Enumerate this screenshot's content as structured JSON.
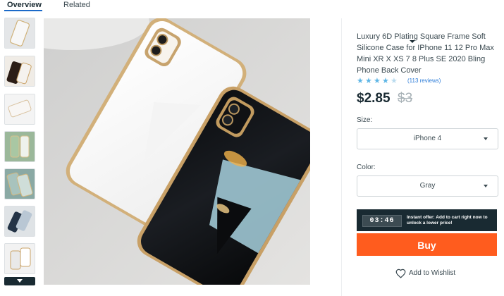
{
  "tabs": [
    {
      "label": "Overview",
      "active": true
    },
    {
      "label": "Related",
      "active": false
    }
  ],
  "gallery": {
    "thumbnail_count": 7,
    "more_icon": "chevron-down-icon"
  },
  "product": {
    "title": "Luxury 6D Plating Square Frame Soft Silicone Case for IPhone 11 12 Pro Max Mini XR X XS 7 8 Plus SE 2020 Bling Phone Back Cover",
    "rating": 4.5,
    "reviews_text": "(113 reviews)",
    "price": "$2.85",
    "original_price": "$3"
  },
  "options": {
    "size_label": "Size:",
    "size_value": "iPhone 4",
    "color_label": "Color:",
    "color_value": "Gray"
  },
  "offer": {
    "timer": "03:46",
    "text": "Instant offer: Add to cart right now to unlock a lower price!"
  },
  "actions": {
    "buy_label": "Buy",
    "wishlist_label": "Add to Wishlist"
  },
  "colors": {
    "accent": "#1b6ac9",
    "buy_button": "#ff5c1e",
    "star": "#5fb6e6",
    "dark": "#192a32"
  }
}
